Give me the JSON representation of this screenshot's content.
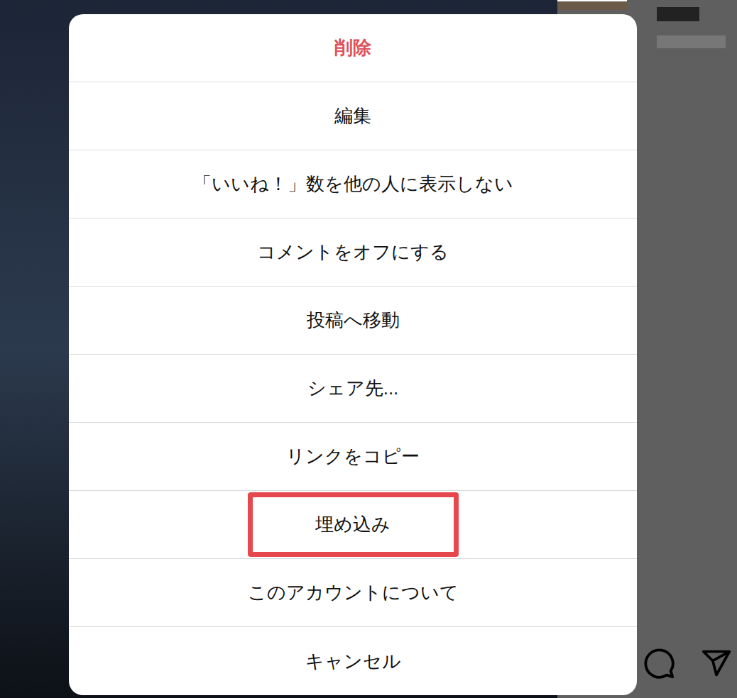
{
  "menu": {
    "items": [
      {
        "label": "削除",
        "danger": true,
        "highlighted": false
      },
      {
        "label": "編集",
        "danger": false,
        "highlighted": false
      },
      {
        "label": "「いいね！」数を他の人に表示しない",
        "danger": false,
        "highlighted": false
      },
      {
        "label": "コメントをオフにする",
        "danger": false,
        "highlighted": false
      },
      {
        "label": "投稿へ移動",
        "danger": false,
        "highlighted": false
      },
      {
        "label": "シェア先...",
        "danger": false,
        "highlighted": false
      },
      {
        "label": "リンクをコピー",
        "danger": false,
        "highlighted": false
      },
      {
        "label": "埋め込み",
        "danger": false,
        "highlighted": true
      },
      {
        "label": "このアカウントについて",
        "danger": false,
        "highlighted": false
      },
      {
        "label": "キャンセル",
        "danger": false,
        "highlighted": false
      }
    ]
  }
}
